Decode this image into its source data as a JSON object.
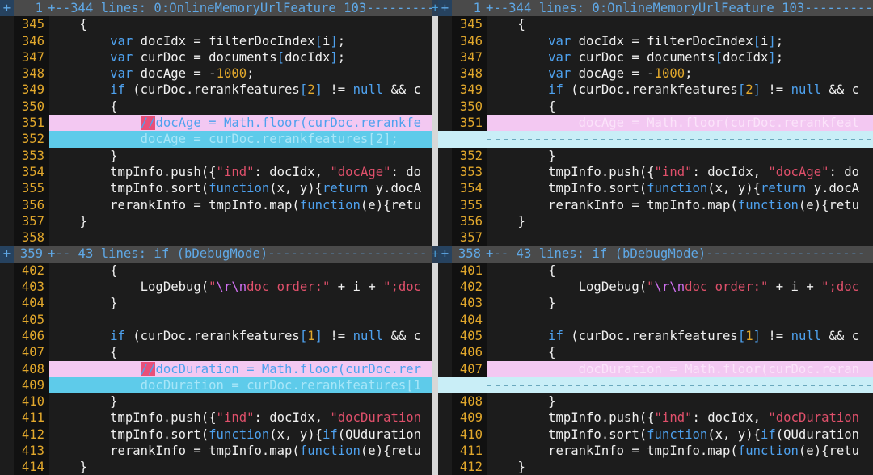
{
  "left": {
    "fold_top": {
      "marker": "+",
      "number": "1",
      "text": "+--344 lines: 0:OnlineMemoryUrlFeature_103---------"
    },
    "block1": [
      {
        "n": "345",
        "kind": "normal",
        "code": "    {"
      },
      {
        "n": "346",
        "kind": "normal",
        "code": "        var docIdx = filterDocIndex[i];"
      },
      {
        "n": "347",
        "kind": "normal",
        "code": "        var curDoc = documents[docIdx];"
      },
      {
        "n": "348",
        "kind": "normal",
        "code": "        var docAge = -1000;"
      },
      {
        "n": "349",
        "kind": "normal",
        "code": "        if (curDoc.rerankfeatures[2] != null && c"
      },
      {
        "n": "350",
        "kind": "normal",
        "code": "        {"
      },
      {
        "n": "351",
        "kind": "change",
        "code": "            //docAge = Math.floor(curDoc.rerankfe"
      },
      {
        "n": "352",
        "kind": "add",
        "code": "            docAge = curDoc.rerankfeatures[2];"
      },
      {
        "n": "353",
        "kind": "normal",
        "code": "        }"
      },
      {
        "n": "354",
        "kind": "normal",
        "code": "        tmpInfo.push({\"ind\": docIdx, \"docAge\": do"
      },
      {
        "n": "355",
        "kind": "normal",
        "code": "        tmpInfo.sort(function(x, y){return y.docA"
      },
      {
        "n": "356",
        "kind": "normal",
        "code": "        rerankInfo = tmpInfo.map(function(e){retu"
      },
      {
        "n": "357",
        "kind": "normal",
        "code": "    }"
      },
      {
        "n": "358",
        "kind": "normal",
        "code": ""
      }
    ],
    "fold_mid": {
      "marker": "+",
      "number": "359",
      "text": "+-- 43 lines: if (bDebugMode)---------------------"
    },
    "block2": [
      {
        "n": "402",
        "kind": "normal",
        "code": "        {"
      },
      {
        "n": "403",
        "kind": "normal",
        "code": "            LogDebug(\"\\r\\ndoc order:\" + i + \";doc"
      },
      {
        "n": "404",
        "kind": "normal",
        "code": "        }"
      },
      {
        "n": "405",
        "kind": "normal",
        "code": ""
      },
      {
        "n": "406",
        "kind": "normal",
        "code": "        if (curDoc.rerankfeatures[1] != null && c"
      },
      {
        "n": "407",
        "kind": "normal",
        "code": "        {"
      },
      {
        "n": "408",
        "kind": "change",
        "code": "            //docDuration = Math.floor(curDoc.rer"
      },
      {
        "n": "409",
        "kind": "add",
        "code": "            docDuration = curDoc.rerankfeatures[1"
      },
      {
        "n": "410",
        "kind": "normal",
        "code": "        }"
      },
      {
        "n": "411",
        "kind": "normal",
        "code": "        tmpInfo.push({\"ind\": docIdx, \"docDuration"
      },
      {
        "n": "412",
        "kind": "normal",
        "code": "        tmpInfo.sort(function(x, y){if(QUduration"
      },
      {
        "n": "413",
        "kind": "normal",
        "code": "        rerankInfo = tmpInfo.map(function(e){retu"
      },
      {
        "n": "414",
        "kind": "normal",
        "code": "    }"
      }
    ]
  },
  "right": {
    "fold_top": {
      "marker": "+",
      "number": "1",
      "text": "+--344 lines: 0:OnlineMemoryUrlFeature_103---------"
    },
    "block1": [
      {
        "n": "345",
        "kind": "normal",
        "code": "    {"
      },
      {
        "n": "346",
        "kind": "normal",
        "code": "        var docIdx = filterDocIndex[i];"
      },
      {
        "n": "347",
        "kind": "normal",
        "code": "        var curDoc = documents[docIdx];"
      },
      {
        "n": "348",
        "kind": "normal",
        "code": "        var docAge = -1000;"
      },
      {
        "n": "349",
        "kind": "normal",
        "code": "        if (curDoc.rerankfeatures[2] != null && c"
      },
      {
        "n": "350",
        "kind": "normal",
        "code": "        {"
      },
      {
        "n": "351",
        "kind": "change",
        "code": "            docAge = Math.floor(curDoc.rerankfeat"
      },
      {
        "n": "",
        "kind": "filler",
        "code": ""
      },
      {
        "n": "352",
        "kind": "normal",
        "code": "        }"
      },
      {
        "n": "353",
        "kind": "normal",
        "code": "        tmpInfo.push({\"ind\": docIdx, \"docAge\": do"
      },
      {
        "n": "354",
        "kind": "normal",
        "code": "        tmpInfo.sort(function(x, y){return y.docA"
      },
      {
        "n": "355",
        "kind": "normal",
        "code": "        rerankInfo = tmpInfo.map(function(e){retu"
      },
      {
        "n": "356",
        "kind": "normal",
        "code": "    }"
      },
      {
        "n": "357",
        "kind": "normal",
        "code": ""
      }
    ],
    "fold_mid": {
      "marker": "+",
      "number": "358",
      "text": "+-- 43 lines: if (bDebugMode)---------------------"
    },
    "block2": [
      {
        "n": "401",
        "kind": "normal",
        "code": "        {"
      },
      {
        "n": "402",
        "kind": "normal",
        "code": "            LogDebug(\"\\r\\ndoc order:\" + i + \";doc"
      },
      {
        "n": "403",
        "kind": "normal",
        "code": "        }"
      },
      {
        "n": "404",
        "kind": "normal",
        "code": ""
      },
      {
        "n": "405",
        "kind": "normal",
        "code": "        if (curDoc.rerankfeatures[1] != null && c"
      },
      {
        "n": "406",
        "kind": "normal",
        "code": "        {"
      },
      {
        "n": "407",
        "kind": "change",
        "code": "            docDuration = Math.floor(curDoc.reran"
      },
      {
        "n": "",
        "kind": "filler",
        "code": ""
      },
      {
        "n": "408",
        "kind": "normal",
        "code": "        }"
      },
      {
        "n": "409",
        "kind": "normal",
        "code": "        tmpInfo.push({\"ind\": docIdx, \"docDuration"
      },
      {
        "n": "410",
        "kind": "normal",
        "code": "        tmpInfo.sort(function(x, y){if(QUduration"
      },
      {
        "n": "411",
        "kind": "normal",
        "code": "        rerankInfo = tmpInfo.map(function(e){retu"
      },
      {
        "n": "412",
        "kind": "normal",
        "code": "    }"
      }
    ]
  },
  "colors": {
    "background": "#1c1c1c",
    "line_number": "#e2a82c",
    "keyword": "#4ea1ee",
    "string": "#e0506b",
    "escape": "#d070f0",
    "change_bg": "#f3c8f2",
    "add_bg": "#5ecbea",
    "fold_bg": "#4a4a4a",
    "fold_text": "#5fa8e6"
  }
}
